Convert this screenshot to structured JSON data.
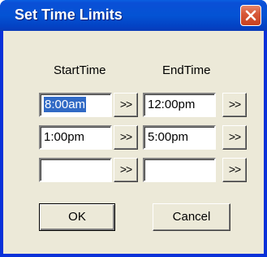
{
  "window": {
    "title": "Set Time Limits",
    "title_color": "#ffffff",
    "titlebar_color": "#0453d4",
    "background_color": "#ece9d8",
    "close_icon": "close-icon"
  },
  "columns": {
    "start_label": "StartTime",
    "end_label": "EndTime"
  },
  "rows": [
    {
      "start": "8:00am",
      "start_selected": true,
      "start_button": ">>",
      "end": "12:00pm",
      "end_button": ">>"
    },
    {
      "start": "1:00pm",
      "start_button": ">>",
      "end": "5:00pm",
      "end_button": ">>"
    },
    {
      "start": "",
      "start_button": ">>",
      "end": "",
      "end_button": ">>"
    }
  ],
  "buttons": {
    "ok": "OK",
    "cancel": "Cancel"
  },
  "selection_color": "#316ac5"
}
